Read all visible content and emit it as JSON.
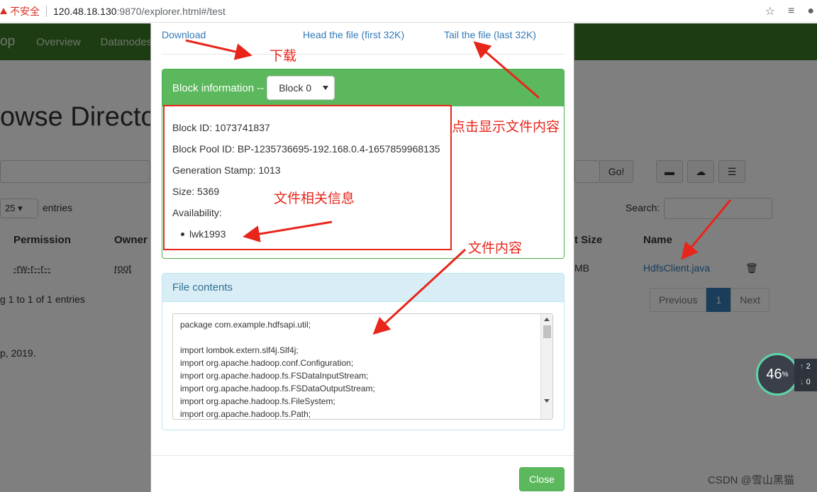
{
  "browser": {
    "security_label": "不安全",
    "url_host": "120.48.18.130",
    "url_rest": ":9870/explorer.html#/test"
  },
  "background": {
    "nav": {
      "brand": "op",
      "items": [
        "Overview",
        "Datanodes"
      ]
    },
    "page_title": "owse Directo",
    "go_button": "Go!",
    "entries_select": "25",
    "entries_label": "entries",
    "search_label": "Search:",
    "table_headers": [
      "Permission",
      "Owner",
      "t Size",
      "Name"
    ],
    "row": {
      "permission": "-rw-r--r--",
      "owner": "root",
      "size": "MB",
      "name": "HdfsClient.java"
    },
    "showing_text": "g 1 to 1 of 1 entries",
    "pager": {
      "previous": "Previous",
      "page": "1",
      "next": "Next"
    },
    "copyright": "p, 2019."
  },
  "modal": {
    "links": {
      "download": "Download",
      "head": "Head the file (first 32K)",
      "tail": "Tail the file (last 32K)"
    },
    "block": {
      "heading": "Block information --",
      "selected": "Block 0",
      "block_id": "Block ID: 1073741837",
      "pool_id": "Block Pool ID: BP-1235736695-192.168.0.4-1657859968135",
      "generation": "Generation Stamp: 1013",
      "size": "Size: 5369",
      "availability": "Availability:",
      "node": "lwk1993"
    },
    "contents": {
      "heading": "File contents",
      "code": "package com.example.hdfsapi.util;\n\nimport lombok.extern.slf4j.Slf4j;\nimport org.apache.hadoop.conf.Configuration;\nimport org.apache.hadoop.fs.FSDataInputStream;\nimport org.apache.hadoop.fs.FSDataOutputStream;\nimport org.apache.hadoop.fs.FileSystem;\nimport org.apache.hadoop.fs.Path;"
    },
    "close": "Close"
  },
  "annotations": {
    "download": "下载",
    "click_show": "点击显示文件内容",
    "file_info": "文件相关信息",
    "file_content": "文件内容"
  },
  "widget": {
    "percent": "46",
    "unit": "%",
    "up": "2",
    "down": "0"
  },
  "watermark": "CSDN @雪山黑猫"
}
